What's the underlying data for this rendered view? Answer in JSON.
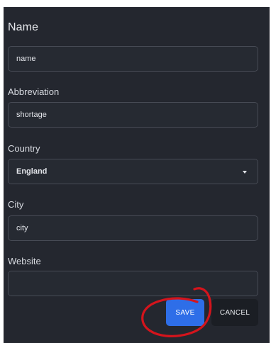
{
  "form": {
    "title": "Name",
    "fields": [
      {
        "label": "",
        "value": "name"
      },
      {
        "label": "Abbreviation",
        "value": "shortage"
      },
      {
        "label": "Country",
        "value": "England"
      },
      {
        "label": "City",
        "value": "city"
      },
      {
        "label": "Website",
        "value": ""
      }
    ]
  },
  "actions": {
    "save_label": "SAVE",
    "cancel_label": "CANCEL"
  },
  "colors": {
    "panel_bg": "#24272f",
    "field_border": "#474b55",
    "save_bg": "#2e6ee8",
    "cancel_bg": "#1b1e24",
    "annotation": "#d4141c"
  },
  "icons": {
    "country_select": "chevron-down-icon"
  }
}
